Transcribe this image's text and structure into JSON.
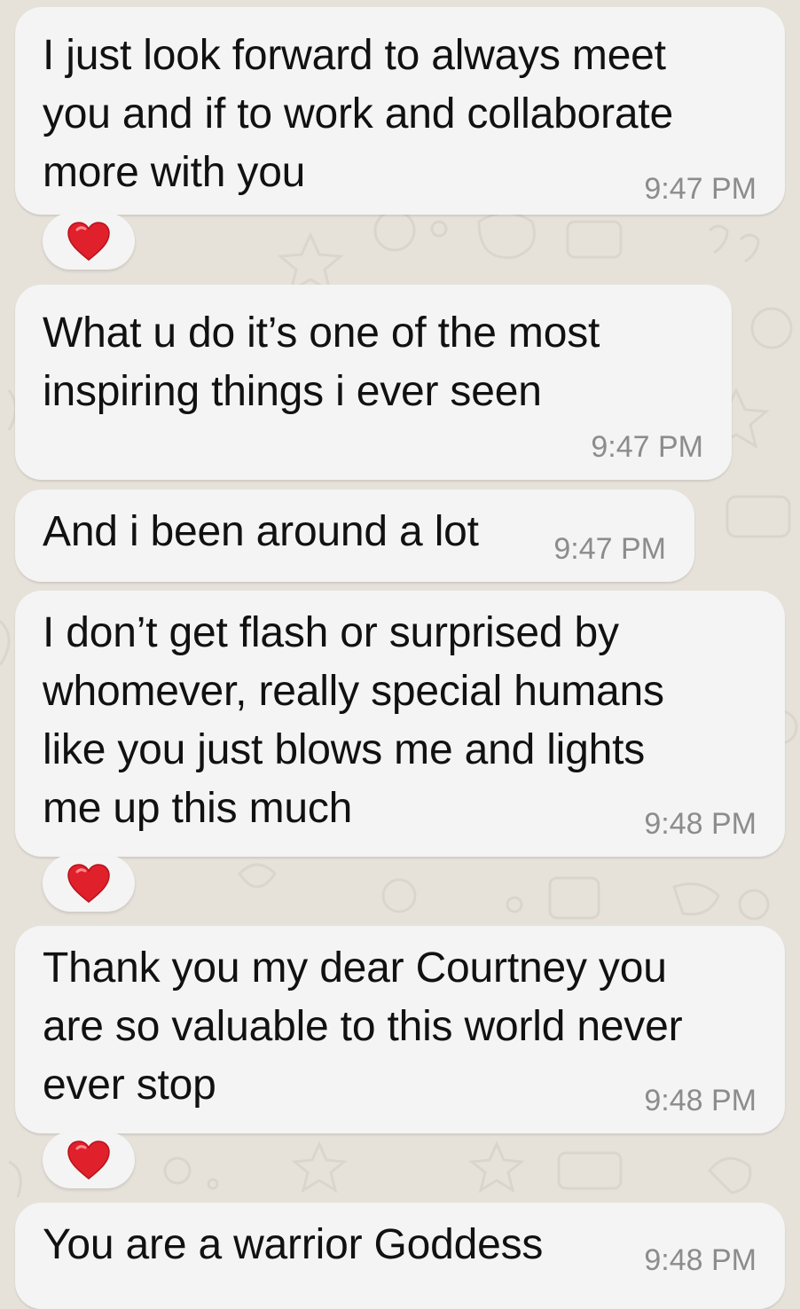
{
  "theme": {
    "background": "#e6e2da",
    "bubble": "#f4f4f4",
    "text": "#111111",
    "time": "#8c8c8c",
    "heart": "#e0202b"
  },
  "messages": [
    {
      "text": "I just look forward to always meet\nyou and if to work and collaborate\nmore with you",
      "time": "9:47 PM",
      "reaction": "heart-icon"
    },
    {
      "text": "What u do it’s one of the most\ninspiring things i ever seen",
      "time": "9:47 PM",
      "reaction": null
    },
    {
      "text": "And i been around a lot",
      "time": "9:47 PM",
      "reaction": null
    },
    {
      "text": "I don’t get flash or surprised by\nwhomever, really special humans\nlike you just blows me and lights\nme up this much",
      "time": "9:48 PM",
      "reaction": "heart-icon"
    },
    {
      "text": "Thank you my dear Courtney you\nare so valuable to this world never\never stop",
      "time": "9:48 PM",
      "reaction": "heart-icon"
    },
    {
      "text": "You are a warrior Goddess",
      "time": "9:48 PM",
      "reaction": null
    }
  ]
}
